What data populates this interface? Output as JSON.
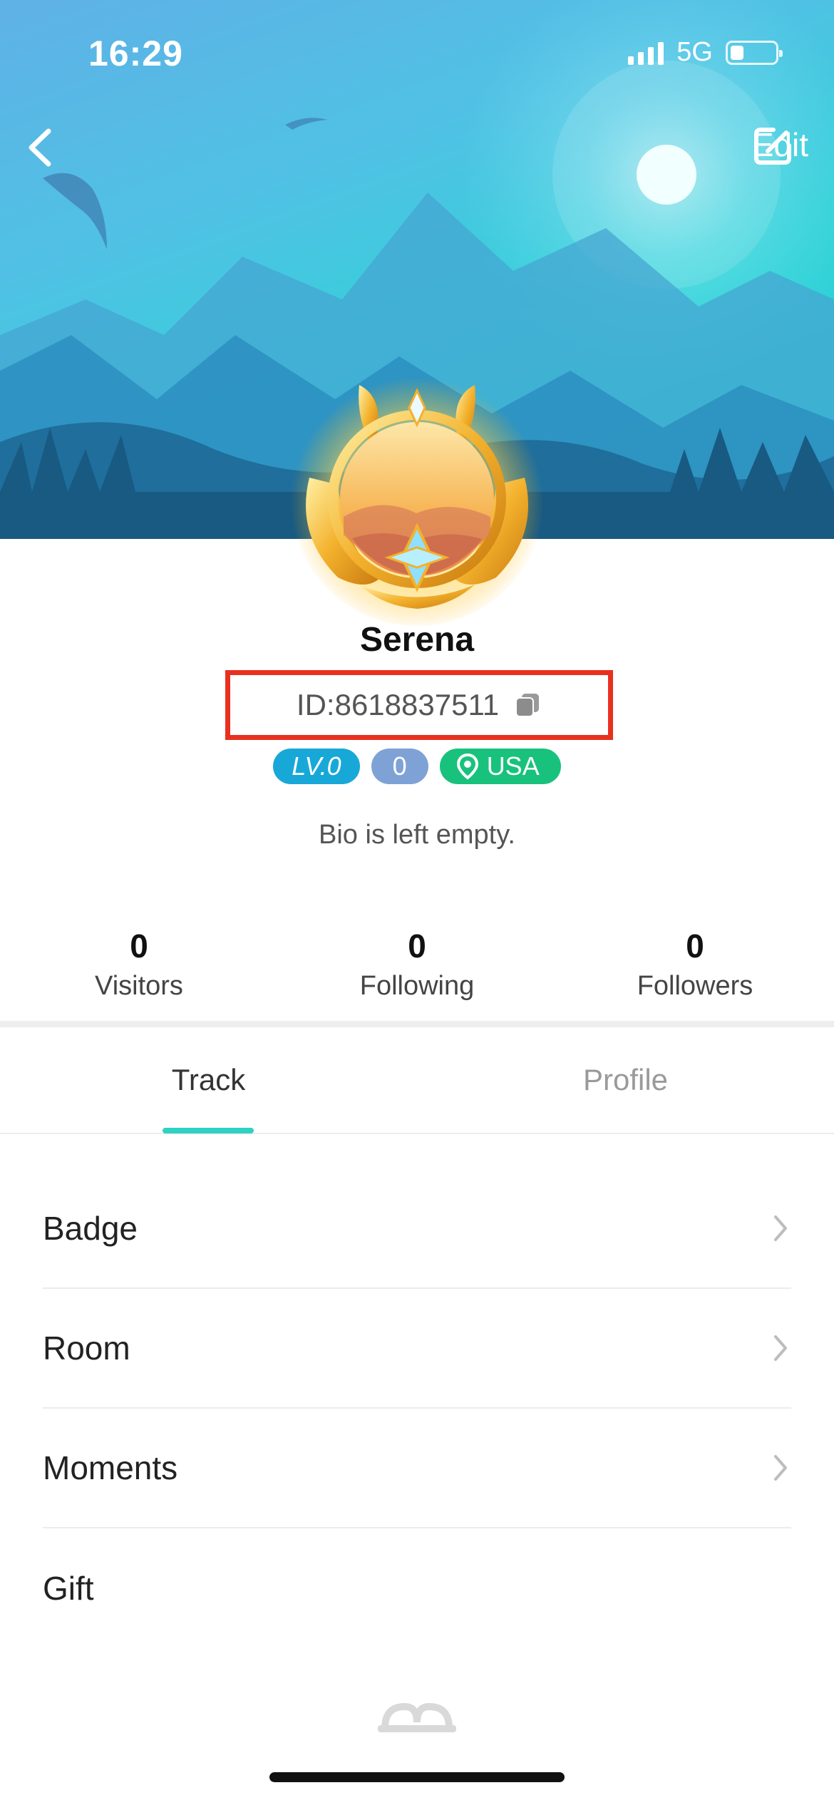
{
  "status_bar": {
    "time": "16:29",
    "network": "5G"
  },
  "header": {
    "edit_label": "Edit"
  },
  "profile": {
    "name": "Serena",
    "id_text": "ID:8618837511",
    "level": "LV.0",
    "count": "0",
    "location": "USA",
    "bio": "Bio is left empty."
  },
  "stats": [
    {
      "value": "0",
      "label": "Visitors"
    },
    {
      "value": "0",
      "label": "Following"
    },
    {
      "value": "0",
      "label": "Followers"
    }
  ],
  "tabs": [
    {
      "label": "Track",
      "active": true
    },
    {
      "label": "Profile",
      "active": false
    }
  ],
  "menu": [
    {
      "label": "Badge"
    },
    {
      "label": "Room"
    },
    {
      "label": "Moments"
    },
    {
      "label": "Gift"
    }
  ],
  "colors": {
    "accent": "#2fd1c4",
    "highlight_border": "#e8301f",
    "level_chip": "#18a8d8",
    "count_chip": "#7fa2d6",
    "location_chip": "#18c27c"
  },
  "icons": {
    "back": "chevron-left-icon",
    "edit": "edit-square-icon",
    "copy": "copy-icon",
    "location": "location-pin-icon",
    "chevron": "chevron-right-icon",
    "gift_empty": "gift-icon"
  }
}
